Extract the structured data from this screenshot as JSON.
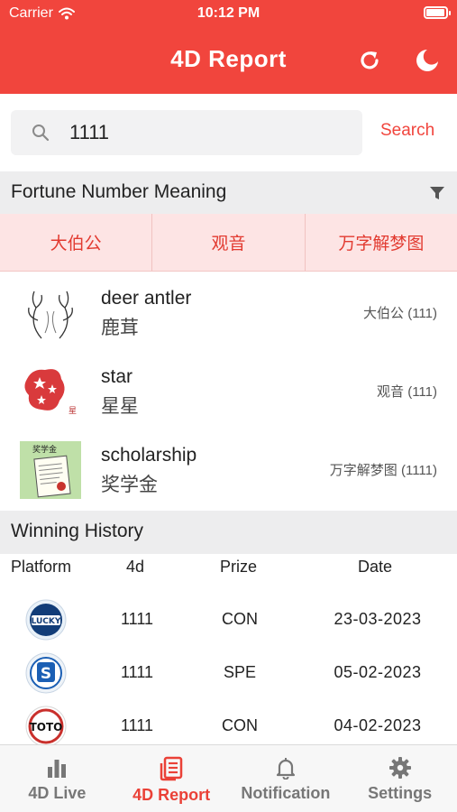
{
  "status_bar": {
    "carrier": "Carrier",
    "time": "10:12 PM",
    "battery_level": 0.95
  },
  "header": {
    "title": "4D Report",
    "refresh_icon": "refresh-icon",
    "theme_icon": "moon-icon",
    "color": "#f1453d"
  },
  "search": {
    "value": "1111",
    "button_label": "Search"
  },
  "fortune": {
    "heading": "Fortune Number Meaning",
    "tabs": [
      {
        "label": "大伯公"
      },
      {
        "label": "观音"
      },
      {
        "label": "万字解梦图"
      }
    ],
    "items": [
      {
        "en": "deer antler",
        "zh": "鹿茸",
        "category": "大伯公 (111)",
        "image": "deer-antler-image"
      },
      {
        "en": "star",
        "zh": "星星",
        "category": "观音 (111)",
        "image": "star-image"
      },
      {
        "en": "scholarship",
        "zh": "奖学金",
        "category": "万字解梦图 (1111)",
        "image": "scholarship-image"
      }
    ]
  },
  "history": {
    "heading": "Winning History",
    "columns": {
      "platform": "Platform",
      "fourd": "4d",
      "prize": "Prize",
      "date": "Date"
    },
    "rows": [
      {
        "platform_logo": "lucky-logo",
        "logo_text": "LUCKY",
        "fourd": "1111",
        "prize": "CON",
        "date": "23-03-2023"
      },
      {
        "platform_logo": "s-logo",
        "logo_text": "S",
        "fourd": "1111",
        "prize": "SPE",
        "date": "05-02-2023"
      },
      {
        "platform_logo": "toto-logo",
        "logo_text": "TOTO",
        "fourd": "1111",
        "prize": "CON",
        "date": "04-02-2023"
      }
    ]
  },
  "tabbar": {
    "items": [
      {
        "label": "4D Live",
        "icon": "bar-chart-icon"
      },
      {
        "label": "4D Report",
        "icon": "report-icon"
      },
      {
        "label": "Notification",
        "icon": "bell-icon"
      },
      {
        "label": "Settings",
        "icon": "gear-icon"
      }
    ],
    "active_color": "#ea4137",
    "inactive_color": "#777777"
  }
}
